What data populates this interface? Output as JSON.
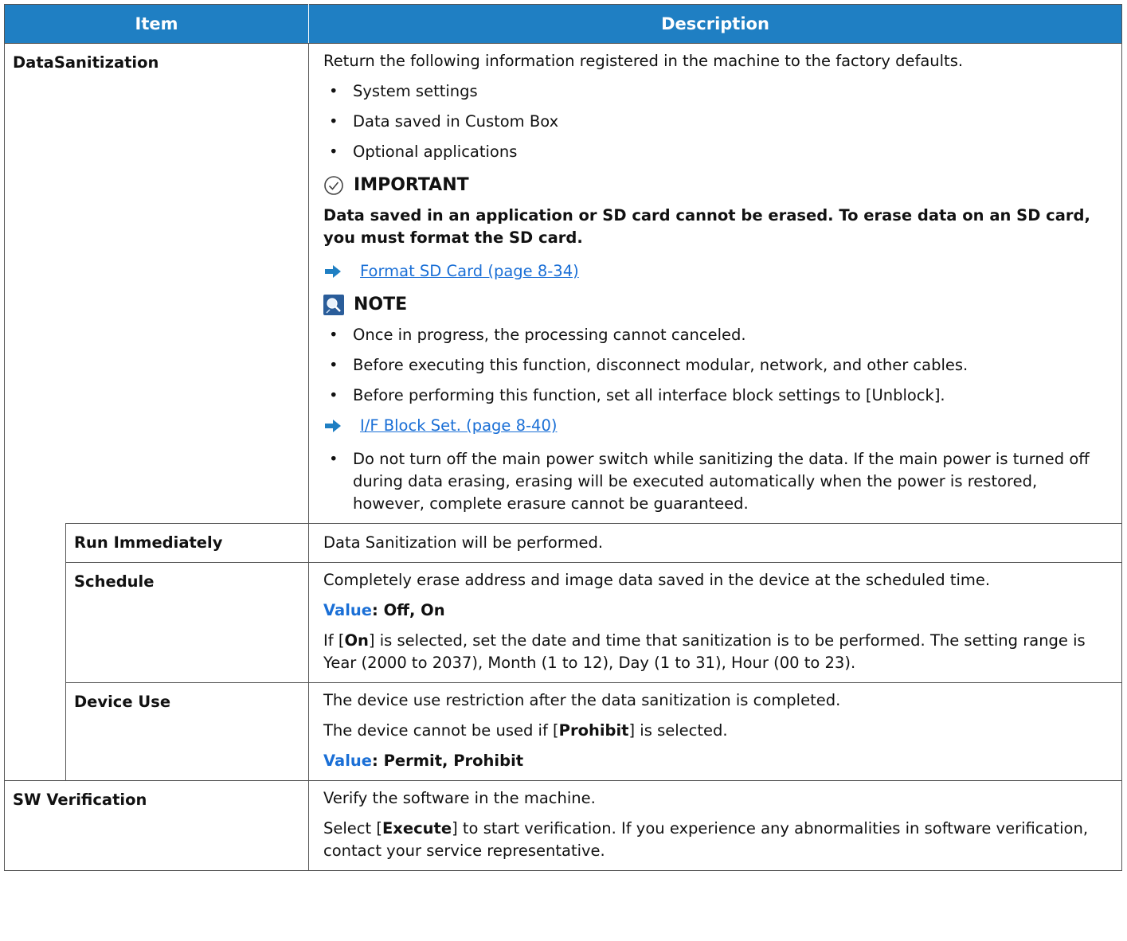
{
  "header": {
    "item": "Item",
    "description": "Description"
  },
  "data_sanitization": {
    "label": "DataSanitization",
    "intro": "Return the following information registered in the machine to the factory defaults.",
    "bullets": [
      "System settings",
      "Data saved in Custom Box",
      "Optional applications"
    ],
    "important_title": "IMPORTANT",
    "important_text": "Data saved in an application or SD card cannot be erased. To erase data on an SD card, you must format the SD card.",
    "link1": "Format SD Card (page 8-34)",
    "note_title": "NOTE",
    "note_bullets": [
      "Once in progress, the processing cannot canceled.",
      "Before executing this function, disconnect modular, network, and other cables.",
      "Before performing this function, set all interface block settings to [Unblock]."
    ],
    "link2": "I/F Block Set. (page 8-40)",
    "last_bullet": "Do not turn off the main power switch while sanitizing the data. If the main power is turned off during data erasing, erasing will be executed automatically when the power is restored, however, complete erasure cannot be guaranteed."
  },
  "run_immediately": {
    "label": "Run Immediately",
    "desc": "Data Sanitization will be performed."
  },
  "schedule": {
    "label": "Schedule",
    "desc": "Completely erase address and image data saved in the device at the scheduled time.",
    "value_label": "Value",
    "value_text": ": Off, On",
    "text_pre": "If [",
    "text_bold": "On",
    "text_post": "] is selected, set the date and time that sanitization is to be performed. The setting range is Year (2000 to 2037), Month (1 to 12), Day (1 to 31), Hour (00 to 23)."
  },
  "device_use": {
    "label": "Device Use",
    "desc1": "The device use restriction after the data sanitization is completed.",
    "desc2_pre": "The device cannot be used if [",
    "desc2_bold": "Prohibit",
    "desc2_post": "] is selected.",
    "value_label": "Value",
    "value_text": ": Permit, Prohibit"
  },
  "sw_verification": {
    "label": "SW Verification",
    "desc1": "Verify the software in the machine.",
    "desc2_pre": "Select [",
    "desc2_bold": "Execute",
    "desc2_post": "] to start verification. If you experience any abnormalities in software verification, contact your service representative."
  },
  "colors": {
    "header_bg": "#1f7fc3",
    "link": "#1a6fd6",
    "value": "#1a6fd6",
    "border": "#555555"
  },
  "icons": [
    "check-circle-icon",
    "arrow-right-icon",
    "note-icon"
  ]
}
